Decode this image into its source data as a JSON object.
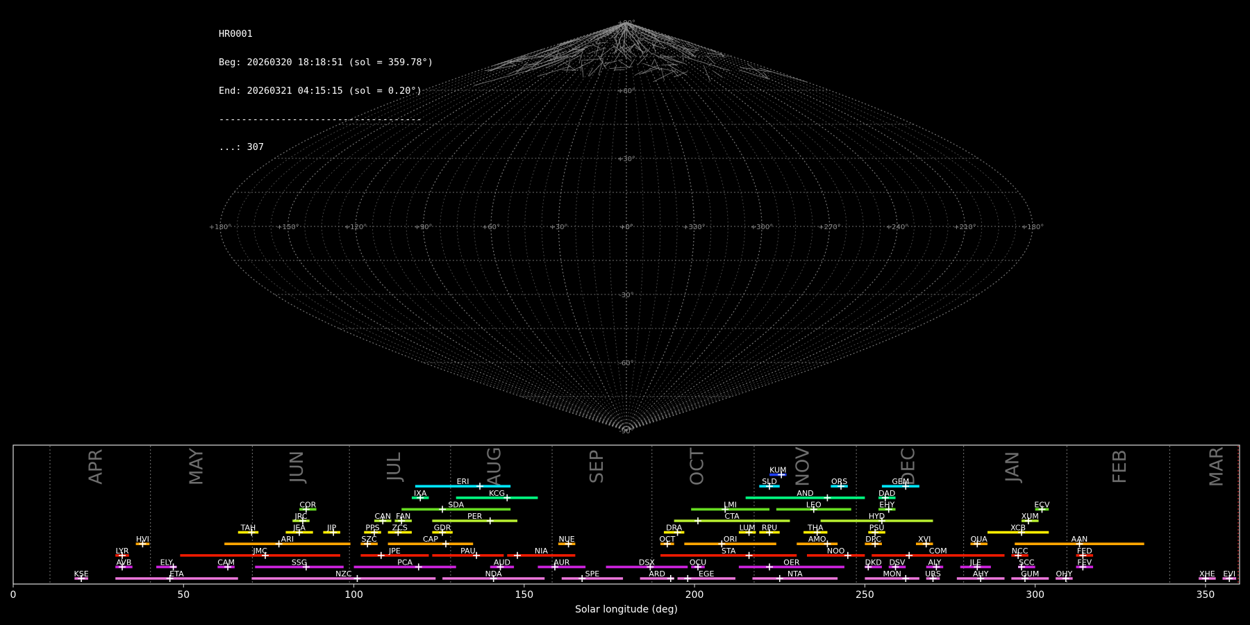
{
  "header": {
    "id": "HR0001",
    "begin": "Beg: 20260320 18:18:51 (sol = 359.78°)",
    "end": "End: 20260321 04:15:15 (sol = 0.20°)",
    "rule": "------------------------------------",
    "count": "...: 307"
  },
  "sky_map": {
    "projection": "sinusoidal",
    "grid_color": "#8c8c8c",
    "lon_labels": [
      "+180°",
      "+150°",
      "+120°",
      "+90°",
      "+60°",
      "+30°",
      "+0°",
      "+330°",
      "+300°",
      "+270°",
      "+240°",
      "+210°",
      "+180°"
    ],
    "lat_labels": [
      "+90°",
      "+60°",
      "+30°",
      "+0°",
      "-30°",
      "-60°",
      "-90°"
    ]
  },
  "chart_data": {
    "type": "timeline",
    "xlabel": "Solar longitude (deg)",
    "xlim": [
      0,
      360
    ],
    "xticks": [
      "0",
      "50",
      "100",
      "150",
      "200",
      "250",
      "300",
      "350"
    ],
    "months": [
      {
        "name": "APR",
        "mid": 24.5
      },
      {
        "name": "MAY",
        "mid": 54
      },
      {
        "name": "JUN",
        "mid": 83.5
      },
      {
        "name": "JUL",
        "mid": 112
      },
      {
        "name": "AUG",
        "mid": 141.5
      },
      {
        "name": "SEP",
        "mid": 171.5
      },
      {
        "name": "OCT",
        "mid": 201
      },
      {
        "name": "NOV",
        "mid": 232
      },
      {
        "name": "DEC",
        "mid": 263
      },
      {
        "name": "JAN",
        "mid": 293.5
      },
      {
        "name": "FEB",
        "mid": 325
      },
      {
        "name": "MAR",
        "mid": 353.5
      }
    ],
    "month_boundaries": [
      10.8,
      40.3,
      70.2,
      98.7,
      128.4,
      158.2,
      187.5,
      217.5,
      247.5,
      279,
      309.3,
      339.5
    ],
    "showers": [
      {
        "code": "KUM",
        "start": 222,
        "end": 227,
        "peak": 225.5,
        "row": 9,
        "color": "#1f3fff"
      },
      {
        "code": "ERI",
        "start": 118,
        "end": 146,
        "peak": 137,
        "row": 8,
        "color": "#00e5ff"
      },
      {
        "code": "SLD",
        "start": 219,
        "end": 225,
        "peak": 222,
        "row": 8,
        "color": "#00e5ff"
      },
      {
        "code": "ORS",
        "start": 240,
        "end": 245,
        "peak": 243,
        "row": 8,
        "color": "#00e5ff"
      },
      {
        "code": "GEM",
        "start": 255,
        "end": 266,
        "peak": 262,
        "row": 8,
        "color": "#00e5ff"
      },
      {
        "code": "IXA",
        "start": 117,
        "end": 122,
        "peak": 119.5,
        "row": 7,
        "color": "#00ff80"
      },
      {
        "code": "KCG",
        "start": 130,
        "end": 154,
        "peak": 145,
        "row": 7,
        "color": "#00ff80"
      },
      {
        "code": "AND",
        "start": 215,
        "end": 250,
        "peak": 239,
        "row": 7,
        "color": "#00ff80"
      },
      {
        "code": "DAD",
        "start": 254,
        "end": 259,
        "peak": 256,
        "row": 7,
        "color": "#00ff80"
      },
      {
        "code": "COR",
        "start": 84,
        "end": 89,
        "peak": 86,
        "row": 6,
        "color": "#66dd22"
      },
      {
        "code": "SDA",
        "start": 114,
        "end": 146,
        "peak": 126,
        "row": 6,
        "color": "#66dd22"
      },
      {
        "code": "LMI",
        "start": 199,
        "end": 222,
        "peak": 209,
        "row": 6,
        "color": "#66dd22"
      },
      {
        "code": "LEO",
        "start": 224,
        "end": 246,
        "peak": 235,
        "row": 6,
        "color": "#66dd22"
      },
      {
        "code": "EHY",
        "start": 254,
        "end": 259,
        "peak": 257,
        "row": 6,
        "color": "#66dd22"
      },
      {
        "code": "ECV",
        "start": 300,
        "end": 304,
        "peak": 302,
        "row": 6,
        "color": "#66dd22"
      },
      {
        "code": "JRC",
        "start": 82,
        "end": 87,
        "peak": 85,
        "row": 5,
        "color": "#b8f030"
      },
      {
        "code": "CAN",
        "start": 106,
        "end": 111,
        "peak": 108.5,
        "row": 5,
        "color": "#b8f030"
      },
      {
        "code": "FAN",
        "start": 112,
        "end": 117,
        "peak": 114,
        "row": 5,
        "color": "#b8f030"
      },
      {
        "code": "PER",
        "start": 123,
        "end": 148,
        "peak": 140,
        "row": 5,
        "color": "#b8f030"
      },
      {
        "code": "CTA",
        "start": 194,
        "end": 228,
        "peak": 201,
        "row": 5,
        "color": "#b8f030"
      },
      {
        "code": "HYD",
        "start": 237,
        "end": 270,
        "peak": 255,
        "row": 5,
        "color": "#b8f030"
      },
      {
        "code": "XUM",
        "start": 296,
        "end": 301,
        "peak": 298,
        "row": 5,
        "color": "#b8f030"
      },
      {
        "code": "TAH",
        "start": 66,
        "end": 72,
        "peak": 70,
        "row": 4,
        "color": "#ffee00"
      },
      {
        "code": "JEA",
        "start": 80,
        "end": 88,
        "peak": 84,
        "row": 4,
        "color": "#ffee00"
      },
      {
        "code": "JIP",
        "start": 91,
        "end": 96,
        "peak": 94,
        "row": 4,
        "color": "#ffee00"
      },
      {
        "code": "PPS",
        "start": 103,
        "end": 108,
        "peak": 106,
        "row": 4,
        "color": "#ffee00"
      },
      {
        "code": "ZCS",
        "start": 110,
        "end": 117,
        "peak": 113,
        "row": 4,
        "color": "#ffee00"
      },
      {
        "code": "GDR",
        "start": 123,
        "end": 129,
        "peak": 126,
        "row": 4,
        "color": "#ffee00"
      },
      {
        "code": "DRA",
        "start": 191,
        "end": 197,
        "peak": 195,
        "row": 4,
        "color": "#ffee00"
      },
      {
        "code": "LUM",
        "start": 213,
        "end": 218,
        "peak": 216,
        "row": 4,
        "color": "#ffee00"
      },
      {
        "code": "RPU",
        "start": 219,
        "end": 225,
        "peak": 222,
        "row": 4,
        "color": "#ffee00"
      },
      {
        "code": "THA",
        "start": 232,
        "end": 239,
        "peak": 236,
        "row": 4,
        "color": "#ffee00"
      },
      {
        "code": "PSU",
        "start": 251,
        "end": 256,
        "peak": 253,
        "row": 4,
        "color": "#ffee00"
      },
      {
        "code": "XCB",
        "start": 286,
        "end": 304,
        "peak": 296,
        "row": 4,
        "color": "#ffee00"
      },
      {
        "code": "HVI",
        "start": 36,
        "end": 40,
        "peak": 38,
        "row": 3,
        "color": "#ffa500"
      },
      {
        "code": "ARI",
        "start": 62,
        "end": 99,
        "peak": 78,
        "row": 3,
        "color": "#ffa500"
      },
      {
        "code": "SZC",
        "start": 102,
        "end": 107,
        "peak": 104,
        "row": 3,
        "color": "#ffa500"
      },
      {
        "code": "CAP",
        "start": 110,
        "end": 135,
        "peak": 127,
        "row": 3,
        "color": "#ffa500"
      },
      {
        "code": "NUE",
        "start": 160,
        "end": 165,
        "peak": 163,
        "row": 3,
        "color": "#ffa500"
      },
      {
        "code": "OCT",
        "start": 190,
        "end": 194,
        "peak": 192,
        "row": 3,
        "color": "#ffa500"
      },
      {
        "code": "ORI",
        "start": 197,
        "end": 224,
        "peak": 208,
        "row": 3,
        "color": "#ffa500"
      },
      {
        "code": "AMO",
        "start": 230,
        "end": 242,
        "peak": 239,
        "row": 3,
        "color": "#ffa500"
      },
      {
        "code": "DPC",
        "start": 250,
        "end": 255,
        "peak": 253,
        "row": 3,
        "color": "#ffa500"
      },
      {
        "code": "XVI",
        "start": 265,
        "end": 270,
        "peak": 268,
        "row": 3,
        "color": "#ffa500"
      },
      {
        "code": "QUA",
        "start": 281,
        "end": 286,
        "peak": 283,
        "row": 3,
        "color": "#ffa500"
      },
      {
        "code": "AAN",
        "start": 294,
        "end": 332,
        "peak": 313,
        "row": 3,
        "color": "#ffa500"
      },
      {
        "code": "LYR",
        "start": 30,
        "end": 34,
        "peak": 32,
        "row": 2,
        "color": "#ee1a00"
      },
      {
        "code": "JMC",
        "start": 49,
        "end": 96,
        "peak": 74,
        "row": 2,
        "color": "#ee1a00"
      },
      {
        "code": "JPE",
        "start": 102,
        "end": 122,
        "peak": 108,
        "row": 2,
        "color": "#ee1a00"
      },
      {
        "code": "PAU",
        "start": 123,
        "end": 144,
        "peak": 136,
        "row": 2,
        "color": "#ee1a00"
      },
      {
        "code": "NIA",
        "start": 145,
        "end": 165,
        "peak": 148,
        "row": 2,
        "color": "#ee1a00"
      },
      {
        "code": "STA",
        "start": 190,
        "end": 230,
        "peak": 216,
        "row": 2,
        "color": "#ee1a00"
      },
      {
        "code": "NOO",
        "start": 233,
        "end": 250,
        "peak": 245,
        "row": 2,
        "color": "#ee1a00"
      },
      {
        "code": "COM",
        "start": 252,
        "end": 291,
        "peak": 263,
        "row": 2,
        "color": "#ee1a00"
      },
      {
        "code": "NCC",
        "start": 293,
        "end": 298,
        "peak": 295,
        "row": 2,
        "color": "#ee1a00"
      },
      {
        "code": "FED",
        "start": 312,
        "end": 317,
        "peak": 314,
        "row": 2,
        "color": "#ee1a00"
      },
      {
        "code": "AVB",
        "start": 30,
        "end": 35,
        "peak": 32,
        "row": 1,
        "color": "#cc22dd"
      },
      {
        "code": "ELY",
        "start": 42,
        "end": 48,
        "peak": 47,
        "row": 1,
        "color": "#cc22dd"
      },
      {
        "code": "CAM",
        "start": 60,
        "end": 65,
        "peak": 63,
        "row": 1,
        "color": "#cc22dd"
      },
      {
        "code": "SSG",
        "start": 71,
        "end": 97,
        "peak": 86,
        "row": 1,
        "color": "#cc22dd"
      },
      {
        "code": "PCA",
        "start": 100,
        "end": 130,
        "peak": 119,
        "row": 1,
        "color": "#cc22dd"
      },
      {
        "code": "AUD",
        "start": 140,
        "end": 147,
        "peak": 143,
        "row": 1,
        "color": "#cc22dd"
      },
      {
        "code": "AUR",
        "start": 154,
        "end": 168,
        "peak": 159,
        "row": 1,
        "color": "#cc22dd"
      },
      {
        "code": "DSX",
        "start": 174,
        "end": 198,
        "peak": 187,
        "row": 1,
        "color": "#cc22dd"
      },
      {
        "code": "OCU",
        "start": 199,
        "end": 203,
        "peak": 201,
        "row": 1,
        "color": "#cc22dd"
      },
      {
        "code": "OER",
        "start": 213,
        "end": 244,
        "peak": 222,
        "row": 1,
        "color": "#cc22dd"
      },
      {
        "code": "DKD",
        "start": 250,
        "end": 255,
        "peak": 251,
        "row": 1,
        "color": "#cc22dd"
      },
      {
        "code": "DSV",
        "start": 257,
        "end": 262,
        "peak": 259,
        "row": 1,
        "color": "#cc22dd"
      },
      {
        "code": "ALY",
        "start": 268,
        "end": 273,
        "peak": 271,
        "row": 1,
        "color": "#cc22dd"
      },
      {
        "code": "JLE",
        "start": 278,
        "end": 287,
        "peak": 283,
        "row": 1,
        "color": "#cc22dd"
      },
      {
        "code": "SCC",
        "start": 295,
        "end": 300,
        "peak": 296,
        "row": 1,
        "color": "#cc22dd"
      },
      {
        "code": "FEV",
        "start": 312,
        "end": 317,
        "peak": 314,
        "row": 1,
        "color": "#cc22dd"
      },
      {
        "code": "KSE",
        "start": 18,
        "end": 22,
        "peak": 20,
        "row": 0,
        "color": "#ee77dd"
      },
      {
        "code": "ETA",
        "start": 30,
        "end": 66,
        "peak": 46,
        "row": 0,
        "color": "#ee77dd"
      },
      {
        "code": "NZC",
        "start": 70,
        "end": 124,
        "peak": 101,
        "row": 0,
        "color": "#ee77dd"
      },
      {
        "code": "NDA",
        "start": 126,
        "end": 156,
        "peak": 141,
        "row": 0,
        "color": "#ee77dd"
      },
      {
        "code": "SPE",
        "start": 161,
        "end": 179,
        "peak": 167,
        "row": 0,
        "color": "#ee77dd"
      },
      {
        "code": "ARD",
        "start": 184,
        "end": 194,
        "peak": 193,
        "row": 0,
        "color": "#ee77dd"
      },
      {
        "code": "EGE",
        "start": 195,
        "end": 212,
        "peak": 198,
        "row": 0,
        "color": "#ee77dd"
      },
      {
        "code": "NTA",
        "start": 217,
        "end": 242,
        "peak": 225,
        "row": 0,
        "color": "#ee77dd"
      },
      {
        "code": "MON",
        "start": 250,
        "end": 266,
        "peak": 262,
        "row": 0,
        "color": "#ee77dd"
      },
      {
        "code": "URS",
        "start": 268,
        "end": 272,
        "peak": 270,
        "row": 0,
        "color": "#ee77dd"
      },
      {
        "code": "AHY",
        "start": 277,
        "end": 291,
        "peak": 284,
        "row": 0,
        "color": "#ee77dd"
      },
      {
        "code": "GUM",
        "start": 293,
        "end": 304,
        "peak": 297,
        "row": 0,
        "color": "#ee77dd"
      },
      {
        "code": "OHY",
        "start": 306,
        "end": 311,
        "peak": 309,
        "row": 0,
        "color": "#ee77dd"
      },
      {
        "code": "XHE",
        "start": 348,
        "end": 353,
        "peak": 350,
        "row": 0,
        "color": "#ee77dd"
      },
      {
        "code": "EVI",
        "start": 355,
        "end": 359,
        "peak": 357,
        "row": 0,
        "color": "#ee77dd"
      }
    ]
  }
}
